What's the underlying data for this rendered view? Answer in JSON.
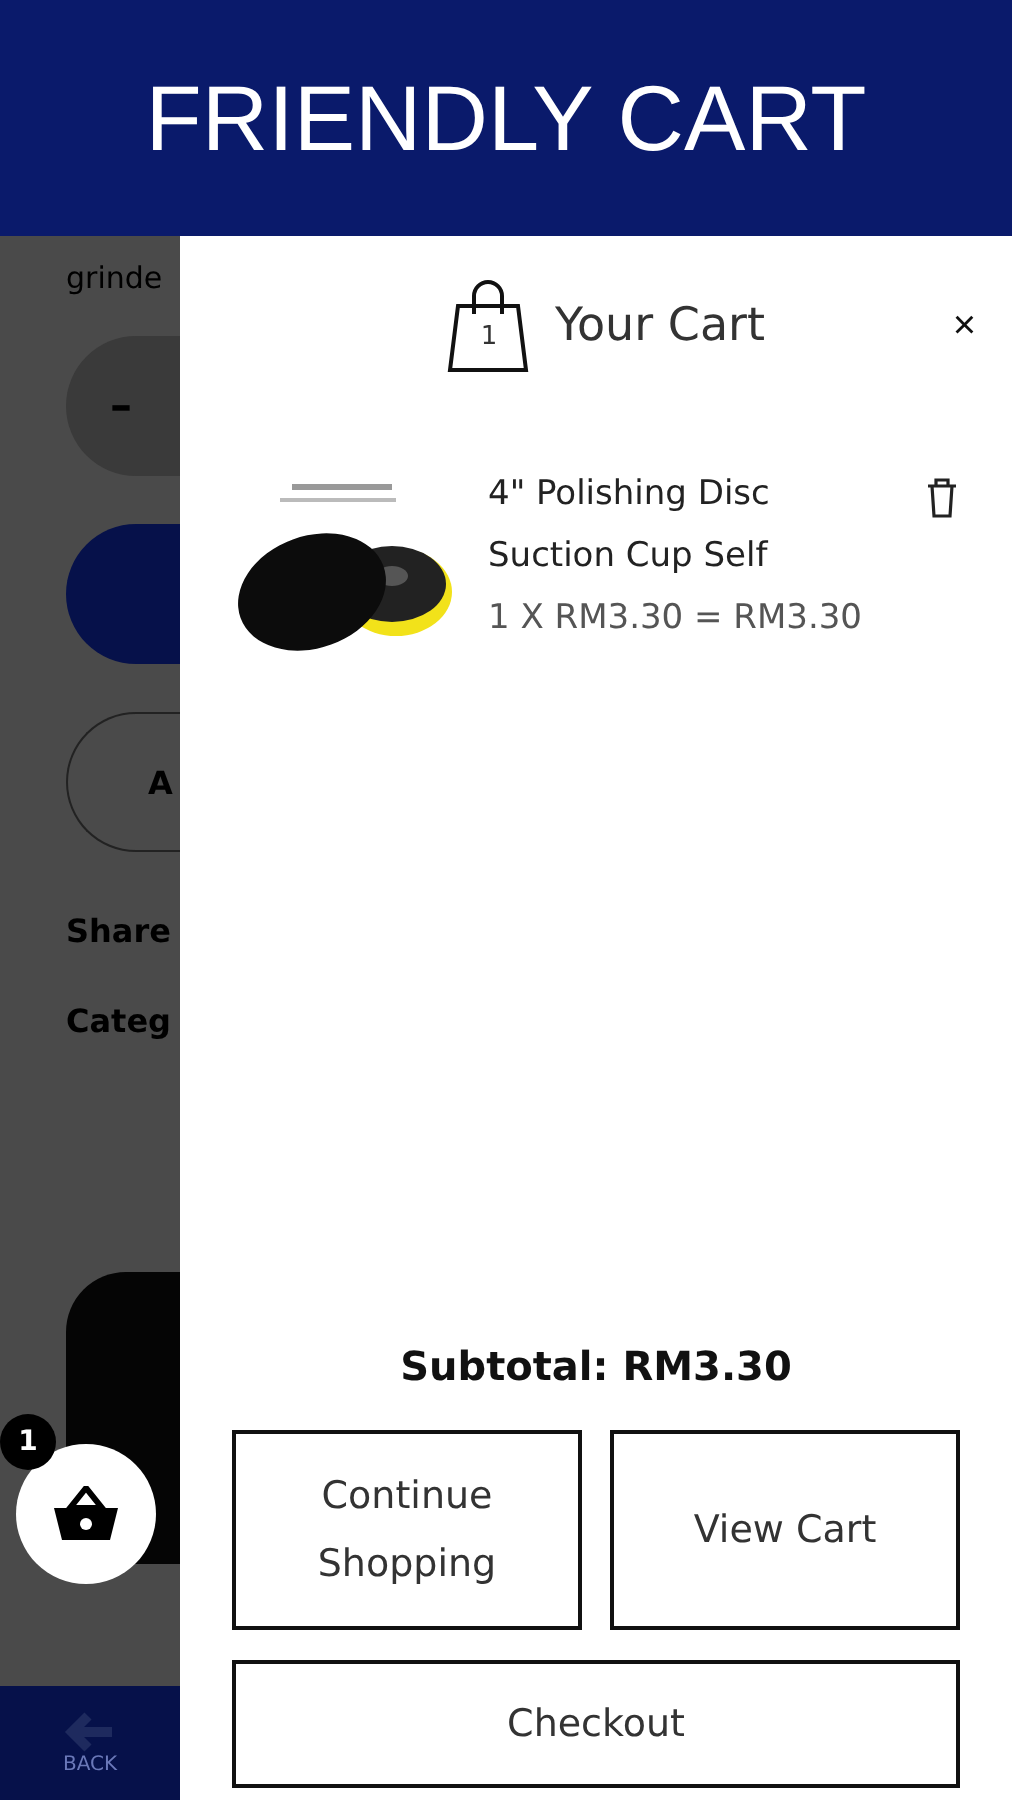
{
  "header": {
    "title": "FRIENDLY CART"
  },
  "background_page": {
    "text": "grinde",
    "quantity_minus": "–",
    "outlined_button": "A",
    "share_label": "Share",
    "category_label": "Categ",
    "cart_badge": "1",
    "back_label": "BACK"
  },
  "cart": {
    "title": "Your Cart",
    "count": "1",
    "close": "×",
    "items": [
      {
        "kind": "picture",
        "name": "4\" Polishing Disc",
        "name_line_2": "Suction Cup Self",
        "price_line": "1 X RM3.30 = RM3.30"
      }
    ],
    "subtotal": "Subtotal: RM3.30",
    "buttons": [
      "Continue Shopping",
      "View Cart"
    ],
    "checkout": "Checkout"
  }
}
